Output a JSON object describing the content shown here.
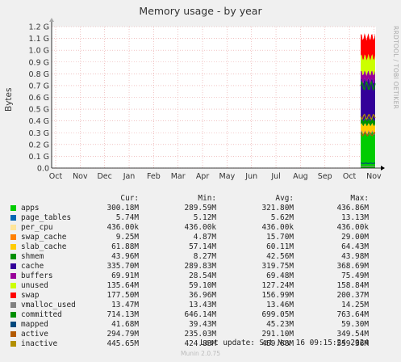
{
  "title": "Memory usage - by year",
  "side_tag": "RRDTOOL / TOBI OETIKER",
  "last_update": "Last update: Sat Nov 16 09:15:24 2024",
  "footer": "Munin 2.0.75",
  "legend_headers": {
    "cur": "Cur:",
    "min": "Min:",
    "avg": "Avg:",
    "max": "Max:"
  },
  "legend": [
    {
      "name": "apps",
      "color": "#00cc00",
      "cur": "300.18M",
      "min": "289.59M",
      "avg": "321.80M",
      "max": "436.86M"
    },
    {
      "name": "page_tables",
      "color": "#0066b3",
      "cur": "5.74M",
      "min": "5.12M",
      "avg": "5.62M",
      "max": "13.13M"
    },
    {
      "name": "per_cpu",
      "color": "#ffe599",
      "cur": "436.00k",
      "min": "436.00k",
      "avg": "436.00k",
      "max": "436.00k"
    },
    {
      "name": "swap_cache",
      "color": "#ff8000",
      "cur": "9.25M",
      "min": "4.87M",
      "avg": "15.70M",
      "max": "29.00M"
    },
    {
      "name": "slab_cache",
      "color": "#ffcc00",
      "cur": "61.88M",
      "min": "57.14M",
      "avg": "60.11M",
      "max": "64.43M"
    },
    {
      "name": "shmem",
      "color": "#008f00",
      "cur": "43.96M",
      "min": "8.27M",
      "avg": "42.56M",
      "max": "43.98M"
    },
    {
      "name": "cache",
      "color": "#330099",
      "cur": "335.70M",
      "min": "289.83M",
      "avg": "319.75M",
      "max": "368.69M"
    },
    {
      "name": "buffers",
      "color": "#990099",
      "cur": "69.91M",
      "min": "28.54M",
      "avg": "69.48M",
      "max": "75.49M"
    },
    {
      "name": "unused",
      "color": "#ccff00",
      "cur": "135.64M",
      "min": "59.10M",
      "avg": "127.24M",
      "max": "158.84M"
    },
    {
      "name": "swap",
      "color": "#ff0000",
      "cur": "177.50M",
      "min": "36.96M",
      "avg": "156.99M",
      "max": "200.37M"
    },
    {
      "name": "vmalloc_used",
      "color": "#808080",
      "cur": "13.47M",
      "min": "13.43M",
      "avg": "13.46M",
      "max": "14.25M"
    },
    {
      "name": "committed",
      "color": "#008f00",
      "cur": "714.13M",
      "min": "646.14M",
      "avg": "699.05M",
      "max": "763.64M"
    },
    {
      "name": "mapped",
      "color": "#00487d",
      "cur": "41.68M",
      "min": "39.43M",
      "avg": "45.23M",
      "max": "59.30M"
    },
    {
      "name": "active",
      "color": "#b35a00",
      "cur": "294.79M",
      "min": "235.03M",
      "avg": "291.10M",
      "max": "349.54M"
    },
    {
      "name": "inactive",
      "color": "#b38f00",
      "cur": "445.65M",
      "min": "424.83M",
      "avg": "459.68M",
      "max": "559.36M"
    }
  ],
  "chart_data": {
    "type": "area",
    "title": "Memory usage - by year",
    "ylabel": "Bytes",
    "yticks": [
      "0.0",
      "0.1 G",
      "0.2 G",
      "0.3 G",
      "0.4 G",
      "0.5 G",
      "0.6 G",
      "0.7 G",
      "0.8 G",
      "0.9 G",
      "1.0 G",
      "1.1 G",
      "1.2 G"
    ],
    "ylim_gb": [
      0,
      1.2
    ],
    "xticks": [
      "Oct",
      "Nov",
      "Dec",
      "Jan",
      "Feb",
      "Mar",
      "Apr",
      "May",
      "Jun",
      "Jul",
      "Aug",
      "Sep",
      "Oct",
      "Nov"
    ],
    "data_span": "late Oct 2024 – Nov 16 2024",
    "stack_order": [
      "apps",
      "page_tables",
      "per_cpu",
      "swap_cache",
      "slab_cache",
      "shmem",
      "cache",
      "buffers",
      "unused",
      "swap"
    ],
    "stack_current_mb": [
      300.18,
      5.74,
      0.44,
      9.25,
      61.88,
      43.96,
      335.7,
      69.91,
      135.64,
      177.5
    ],
    "line_series_current_mb": {
      "committed": 714.13,
      "mapped": 41.68,
      "active": 294.79,
      "inactive": 445.65,
      "vmalloc_used": 13.47
    },
    "grid": true
  }
}
